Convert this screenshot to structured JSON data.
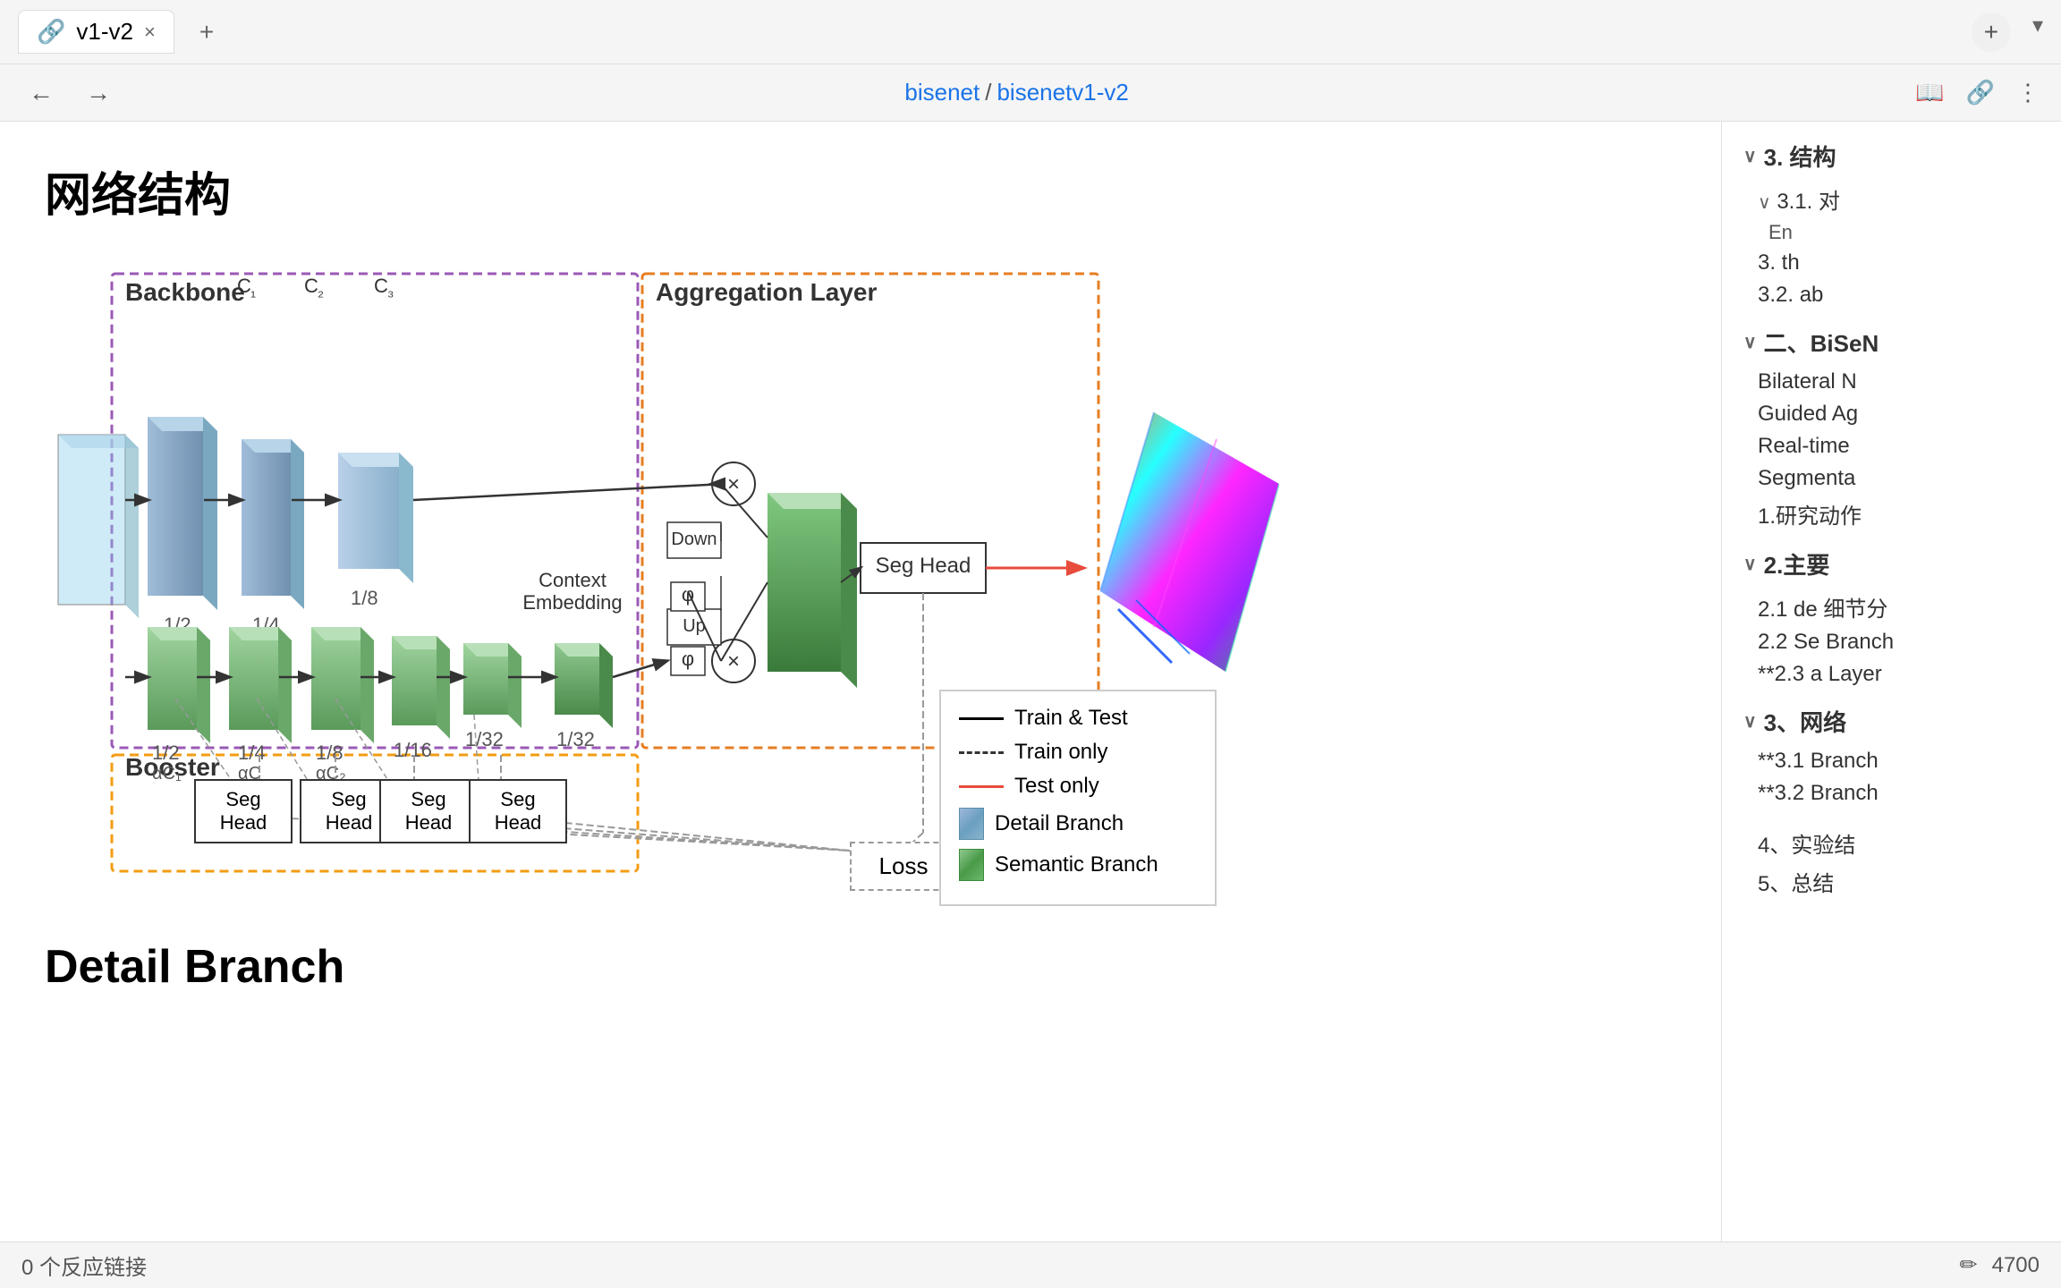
{
  "browser": {
    "tab_title": "v1-v2",
    "tab_icon": "🔗",
    "tab_close": "×",
    "tab_add": "+",
    "nav_back": "←",
    "nav_forward": "→",
    "address": "bisenet / bisenetv1-v2",
    "address_separator": " / ",
    "address_part1": "bisenet",
    "address_part2": "bisenetv1-v2",
    "browser_controls": [
      "📖",
      "🔗",
      "⋮"
    ],
    "profile_icon": "+"
  },
  "page": {
    "title": "网络结构",
    "section_bottom": "Detail Branch"
  },
  "diagram": {
    "backbone_label": "Backbone",
    "backbone_labels_c": [
      "C₁",
      "C₂",
      "C₃"
    ],
    "aggregation_label": "Aggregation Layer",
    "booster_label": "Booster",
    "scale_labels_top": [
      "1/2",
      "1/4",
      "1/8"
    ],
    "scale_labels_bottom": [
      "1/2",
      "1/4",
      "1/8",
      "1/16",
      "1/32",
      "1/32"
    ],
    "alpha_labels": [
      "αC₁",
      "αC",
      "αC₂"
    ],
    "context_label": "Context\nEmbedding",
    "seg_head_labels": [
      "Seg Head",
      "Seg Head",
      "Seg Head",
      "Seg Head"
    ],
    "seg_head_main": "Seg Head",
    "loss_label": "Loss",
    "down_label": "Down",
    "up_label": "Up",
    "phi_label": "φ",
    "phi_label2": "φ",
    "cross_symbol": "×"
  },
  "legend": {
    "train_test": "Train & Test",
    "train_only": "Train only",
    "test_only": "Test only",
    "detail_branch": "Detail Branch",
    "semantic_branch": "Semantic Branch"
  },
  "sidebar": {
    "items": [
      {
        "label": "3. 结构",
        "level": 1,
        "collapsed": false
      },
      {
        "label": "3.1. 对",
        "level": 2
      },
      {
        "label": "En",
        "level": 3
      },
      {
        "label": "3. th",
        "level": 2
      },
      {
        "label": "3.2. ab",
        "level": 2
      },
      {
        "label": "二、BiSeN",
        "level": 1,
        "collapsed": false
      },
      {
        "label": "Bilateral N",
        "level": 2
      },
      {
        "label": "Guided Ag",
        "level": 2
      },
      {
        "label": "Real-time",
        "level": 2
      },
      {
        "label": "Segmenta",
        "level": 2
      },
      {
        "label": "1.研究动作",
        "level": 2
      },
      {
        "label": "2.主要",
        "level": 1,
        "collapsed": false
      },
      {
        "label": "2.1 de 细节分",
        "level": 2
      },
      {
        "label": "2.2 Se Branch",
        "level": 2
      },
      {
        "label": "**2.3 a Layer",
        "level": 2
      },
      {
        "label": "3、网络",
        "level": 1,
        "collapsed": false
      },
      {
        "label": "**3.1 Branch",
        "level": 2
      },
      {
        "label": "**3.2 Branch",
        "level": 2
      },
      {
        "label": "4、实验结",
        "level": 1
      },
      {
        "label": "5、总结",
        "level": 1
      }
    ]
  },
  "bottom_bar": {
    "reactions": "0 个反应链接",
    "edit_icon": "✏",
    "count": "4700"
  }
}
